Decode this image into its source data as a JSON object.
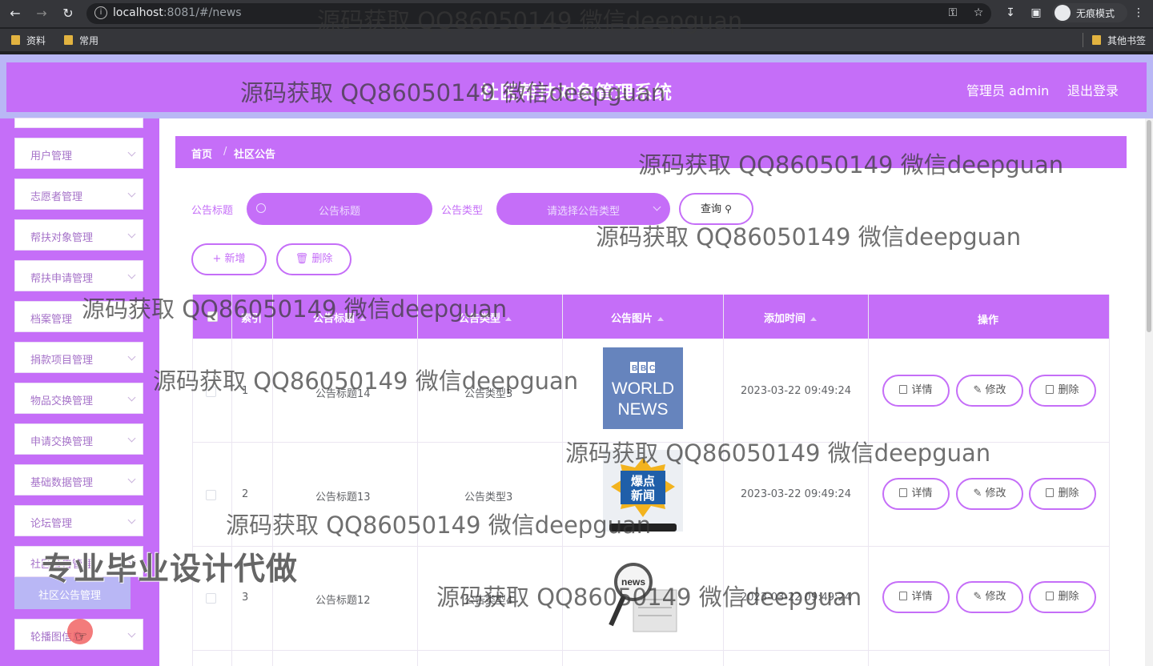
{
  "browser": {
    "url_host": "localhost",
    "url_rest": ":8081/#/news",
    "incognito_label": "无痕模式",
    "bookmarks": [
      "资料",
      "常用"
    ],
    "other_bookmarks": "其他书签"
  },
  "header": {
    "title": "社区帮扶对象管理系统",
    "admin": "管理员 admin",
    "logout": "退出登录"
  },
  "sidebar": {
    "items": [
      "用户管理",
      "志愿者管理",
      "帮扶对象管理",
      "帮扶申请管理",
      "档案管理",
      "捐款项目管理",
      "物品交换管理",
      "申请交换管理",
      "基础数据管理",
      "论坛管理",
      "社区公告管理",
      "轮播图信息"
    ],
    "active": "社区公告管理"
  },
  "breadcrumb": {
    "home": "首页",
    "current": "社区公告"
  },
  "filters": {
    "title_label": "公告标题",
    "title_placeholder": "公告标题",
    "type_label": "公告类型",
    "type_placeholder": "请选择公告类型",
    "query_button": "查询"
  },
  "actions": {
    "add": "新增",
    "delete": "删除"
  },
  "table": {
    "columns": [
      "索引",
      "公告标题",
      "公告类型",
      "公告图片",
      "添加时间",
      "操作"
    ],
    "rows": [
      {
        "index": "1",
        "title": "公告标题14",
        "type": "公告类型3",
        "image": "BBC WORLD NEWS",
        "time": "2023-03-22 09:49:24"
      },
      {
        "index": "2",
        "title": "公告标题13",
        "type": "公告类型3",
        "image": "爆点新闻",
        "time": "2023-03-22 09:49:24"
      },
      {
        "index": "3",
        "title": "公告标题12",
        "type": "公告类型4",
        "image": "news",
        "time": "2023-03-22 09:49:24"
      }
    ],
    "row_actions": {
      "detail": "详情",
      "edit": "修改",
      "delete": "删除"
    }
  },
  "watermarks": {
    "text": "源码获取 QQ86050149 微信deepguan",
    "promo": "专业毕业设计代做"
  },
  "colors": {
    "primary": "#c56ef8",
    "header_outer": "#b9b7f5",
    "active_menu": "#b9b7f5"
  }
}
